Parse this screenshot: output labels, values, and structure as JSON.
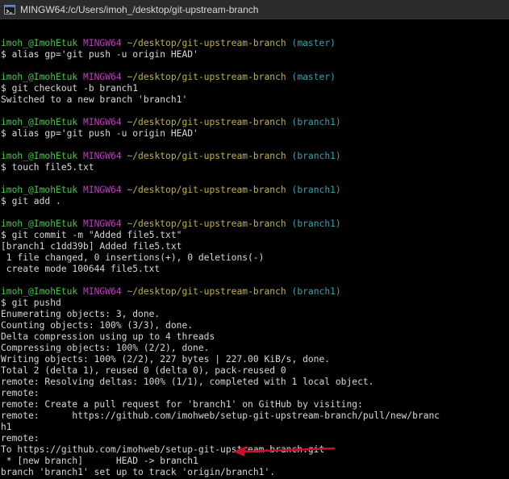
{
  "window": {
    "title": "MINGW64:/c/Users/imoh_/desktop/git-upstream-branch",
    "icon": "mingw-terminal-icon"
  },
  "colors": {
    "background": "#000000",
    "text": "#d8d8d8",
    "user": "#45c945",
    "system": "#bf3cbf",
    "path": "#c2b43a",
    "branch": "#2aa7b5",
    "annotation_arrow": "#c8102e"
  },
  "terminal": {
    "lines": [
      {
        "type": "blank"
      },
      {
        "type": "prompt",
        "user": "imoh_@ImohEtuk",
        "system": "MINGW64",
        "path": "~/desktop/git-upstream-branch",
        "branch": "(master)"
      },
      {
        "type": "cmd",
        "text": "$ alias gp='git push -u origin HEAD'"
      },
      {
        "type": "blank"
      },
      {
        "type": "prompt",
        "user": "imoh_@ImohEtuk",
        "system": "MINGW64",
        "path": "~/desktop/git-upstream-branch",
        "branch": "(master)"
      },
      {
        "type": "cmd",
        "text": "$ git checkout -b branch1"
      },
      {
        "type": "out",
        "text": "Switched to a new branch 'branch1'"
      },
      {
        "type": "blank"
      },
      {
        "type": "prompt",
        "user": "imoh_@ImohEtuk",
        "system": "MINGW64",
        "path": "~/desktop/git-upstream-branch",
        "branch": "(branch1)"
      },
      {
        "type": "cmd",
        "text": "$ alias gp='git push -u origin HEAD'"
      },
      {
        "type": "blank"
      },
      {
        "type": "prompt",
        "user": "imoh_@ImohEtuk",
        "system": "MINGW64",
        "path": "~/desktop/git-upstream-branch",
        "branch": "(branch1)"
      },
      {
        "type": "cmd",
        "text": "$ touch file5.txt"
      },
      {
        "type": "blank"
      },
      {
        "type": "prompt",
        "user": "imoh_@ImohEtuk",
        "system": "MINGW64",
        "path": "~/desktop/git-upstream-branch",
        "branch": "(branch1)"
      },
      {
        "type": "cmd",
        "text": "$ git add ."
      },
      {
        "type": "blank"
      },
      {
        "type": "prompt",
        "user": "imoh_@ImohEtuk",
        "system": "MINGW64",
        "path": "~/desktop/git-upstream-branch",
        "branch": "(branch1)"
      },
      {
        "type": "cmd",
        "text": "$ git commit -m \"Added file5.txt\""
      },
      {
        "type": "out",
        "text": "[branch1 c1dd39b] Added file5.txt"
      },
      {
        "type": "out",
        "text": " 1 file changed, 0 insertions(+), 0 deletions(-)"
      },
      {
        "type": "out",
        "text": " create mode 100644 file5.txt"
      },
      {
        "type": "blank"
      },
      {
        "type": "prompt",
        "user": "imoh_@ImohEtuk",
        "system": "MINGW64",
        "path": "~/desktop/git-upstream-branch",
        "branch": "(branch1)"
      },
      {
        "type": "cmd",
        "text": "$ git pushd"
      },
      {
        "type": "out",
        "text": "Enumerating objects: 3, done."
      },
      {
        "type": "out",
        "text": "Counting objects: 100% (3/3), done."
      },
      {
        "type": "out",
        "text": "Delta compression using up to 4 threads"
      },
      {
        "type": "out",
        "text": "Compressing objects: 100% (2/2), done."
      },
      {
        "type": "out",
        "text": "Writing objects: 100% (2/2), 227 bytes | 227.00 KiB/s, done."
      },
      {
        "type": "out",
        "text": "Total 2 (delta 1), reused 0 (delta 0), pack-reused 0"
      },
      {
        "type": "out",
        "text": "remote: Resolving deltas: 100% (1/1), completed with 1 local object."
      },
      {
        "type": "out",
        "text": "remote:"
      },
      {
        "type": "out",
        "text": "remote: Create a pull request for 'branch1' on GitHub by visiting:"
      },
      {
        "type": "out",
        "text": "remote:      https://github.com/imohweb/setup-git-upstream-branch/pull/new/branc"
      },
      {
        "type": "out",
        "text": "h1"
      },
      {
        "type": "out",
        "text": "remote:"
      },
      {
        "type": "out",
        "text": "To https://github.com/imohweb/setup-git-upstream-branch.git"
      },
      {
        "type": "out",
        "text": " * [new branch]      HEAD -> branch1"
      },
      {
        "type": "out",
        "text": "branch 'branch1' set up to track 'origin/branch1'."
      }
    ]
  }
}
